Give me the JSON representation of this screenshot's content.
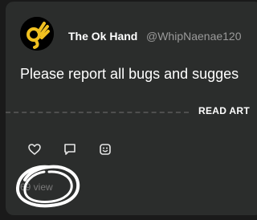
{
  "post": {
    "author_name": "The Ok Hand",
    "author_handle": "@WhipNaenae120",
    "body": "Please report all bugs and sugges",
    "read_article_label": "READ ART",
    "views_label": "69 view"
  },
  "icons": {
    "avatar": "ok-hand-emoji",
    "like": "heart-outline-icon",
    "comment": "speech-bubble-icon",
    "react": "emoji-face-icon"
  },
  "colors": {
    "page_background": "#1a1a1a",
    "card_background": "#2b2d2c",
    "avatar_accent": "#f0c020",
    "text_primary": "#ffffff",
    "text_muted": "#9a9a9a"
  }
}
